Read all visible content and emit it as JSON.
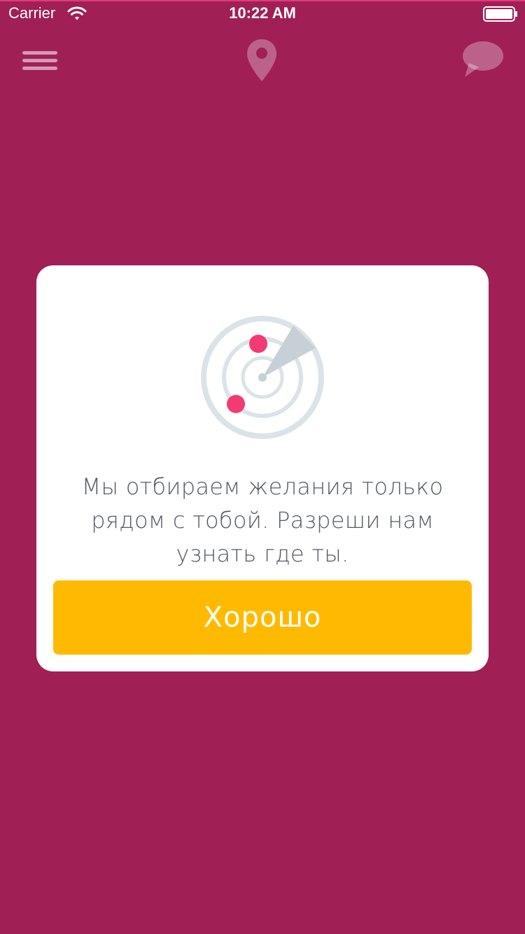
{
  "status_bar": {
    "carrier": "Carrier",
    "time": "10:22 AM"
  },
  "nav": {
    "menu_icon": "hamburger-menu-icon",
    "location_icon": "location-pin-icon",
    "chat_icon": "chat-bubble-icon"
  },
  "modal": {
    "illustration_icon": "radar-icon",
    "message": "Мы отбираем желания только рядом с тобой. Разреши нам узнать где ты.",
    "button_label": "Хорошо"
  },
  "colors": {
    "background": "#a01f55",
    "button": "#ffba00",
    "dot": "#f23a75",
    "radar_ring": "#dbe3e8"
  }
}
